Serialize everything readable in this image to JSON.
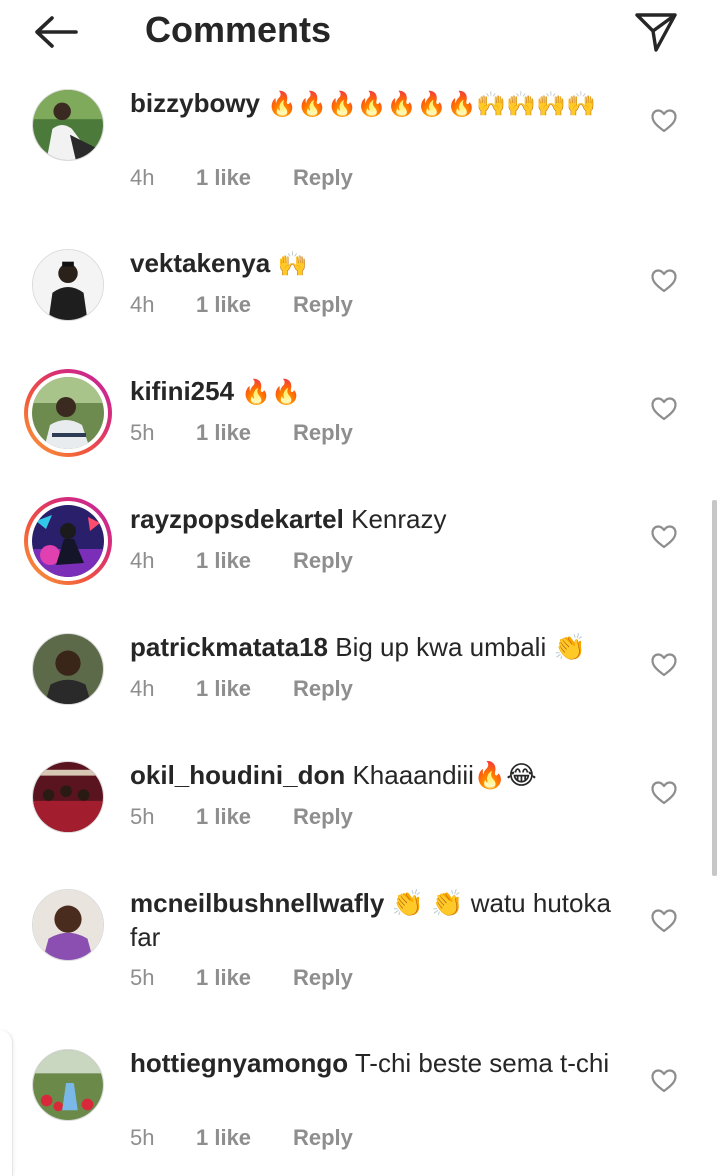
{
  "header": {
    "title": "Comments",
    "back_icon": "arrow-left-icon",
    "share_icon": "paper-plane-icon"
  },
  "colors": {
    "text": "#262626",
    "secondary": "#8e8e8e",
    "story_ring": [
      "#f9a43a",
      "#d92f6f",
      "#c224a6"
    ]
  },
  "comments": [
    {
      "username": "bizzybowy",
      "text": "🔥🔥🔥🔥🔥🔥🔥🙌🙌🙌🙌",
      "time": "4h",
      "likes": "1 like",
      "reply": "Reply",
      "story_ring": false
    },
    {
      "username": "vektakenya",
      "text": "🙌",
      "time": "4h",
      "likes": "1 like",
      "reply": "Reply",
      "story_ring": false
    },
    {
      "username": "kifini254",
      "text": "🔥🔥",
      "time": "5h",
      "likes": "1 like",
      "reply": "Reply",
      "story_ring": true
    },
    {
      "username": "rayzpopsdekartel",
      "text": "Kenrazy",
      "time": "4h",
      "likes": "1 like",
      "reply": "Reply",
      "story_ring": true
    },
    {
      "username": "patrickmatata18",
      "text": "Big up kwa umbali 👏",
      "time": "4h",
      "likes": "1 like",
      "reply": "Reply",
      "story_ring": false
    },
    {
      "username": "okil_houdini_don",
      "text": "Khaaandiii🔥😂",
      "time": "5h",
      "likes": "1 like",
      "reply": "Reply",
      "story_ring": false
    },
    {
      "username": "mcneilbushnellwafly",
      "text": "👏 👏 watu hutoka far",
      "time": "5h",
      "likes": "1 like",
      "reply": "Reply",
      "story_ring": false
    },
    {
      "username": "hottiegnyamongo",
      "text": "T-chi beste sema t-chi",
      "time": "5h",
      "likes": "1 like",
      "reply": "Reply",
      "story_ring": false
    }
  ]
}
